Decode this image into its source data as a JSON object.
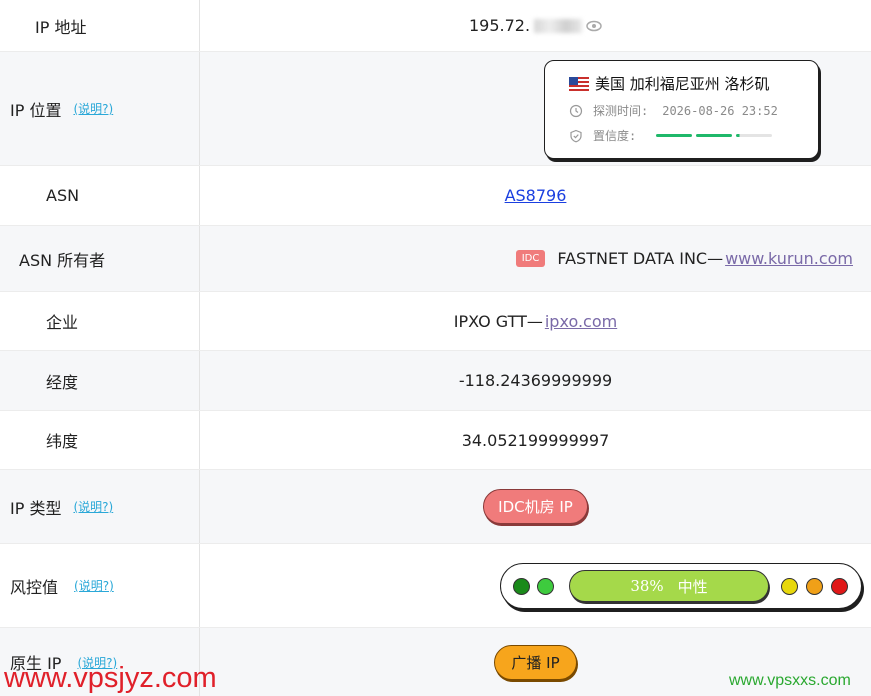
{
  "rows": {
    "ip": {
      "label": "IP 地址",
      "value_prefix": "195.72."
    },
    "location": {
      "label": "IP 位置",
      "help": "(说明?)"
    },
    "asn": {
      "label": "ASN",
      "value": "AS8796"
    },
    "asn_owner": {
      "label": "ASN 所有者",
      "badge": "IDC",
      "name": "FASTNET DATA INC—",
      "domain": "www.kurun.com"
    },
    "company": {
      "label": "企业",
      "name": "IPXO GTT—",
      "domain": "ipxo.com"
    },
    "longitude": {
      "label": "经度",
      "value": "-118.24369999999"
    },
    "latitude": {
      "label": "纬度",
      "value": "34.052199999997"
    },
    "ip_type": {
      "label": "IP 类型",
      "help": "(说明?)",
      "value": "IDC机房 IP"
    },
    "risk": {
      "label": "风控值",
      "help": "(说明?)",
      "percent": "38%",
      "level": "中性",
      "score": 0.38
    },
    "native_ip": {
      "label": "原生 IP",
      "help": "(说明?)",
      "value": "广播 IP"
    }
  },
  "location_card": {
    "flag": "us-flag",
    "place": "美国 加利福尼亚州 洛杉矶",
    "time_label": "探测时间:",
    "time_value": "2026-08-26 23:52",
    "confidence_label": "置信度:",
    "confidence_segments_filled": 2.1
  },
  "watermarks": {
    "left": "www.vpsjyz.com",
    "right": "www.vpsxxs.com"
  },
  "colors": {
    "accent_red": "#f07b7b",
    "accent_orange": "#f7a51c",
    "risk_green": "#a5d94a",
    "link_blue": "#1a3fe0"
  }
}
